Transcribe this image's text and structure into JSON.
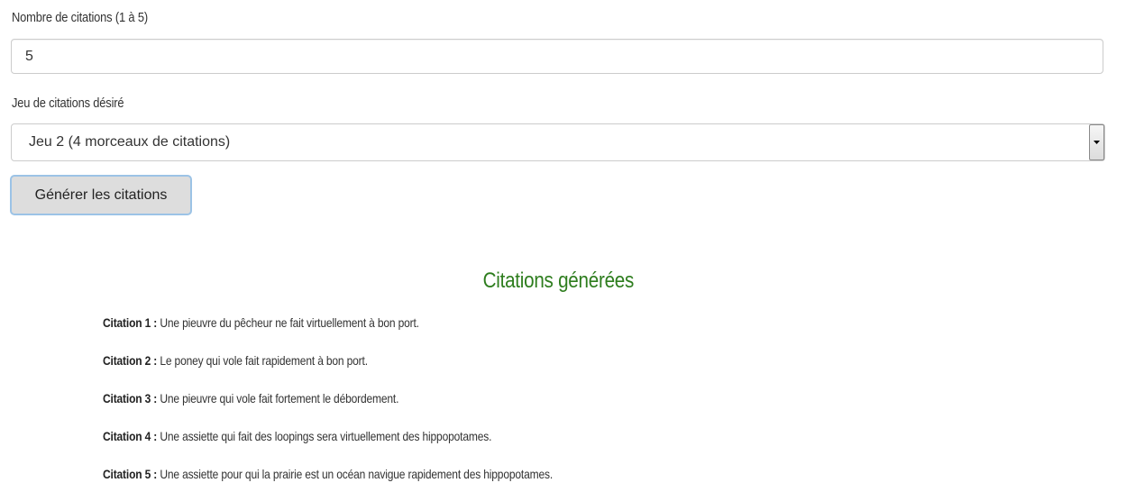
{
  "form": {
    "count_label": "Nombre de citations (1 à 5)",
    "count_value": "5",
    "set_label": "Jeu de citations désiré",
    "set_selected": "Jeu 2 (4 morceaux de citations)",
    "generate_label": "Générer les citations"
  },
  "results": {
    "title": "Citations générées",
    "color": "#2e7d1e",
    "quotes": [
      {
        "label": "Citation 1 :",
        "text": " Une pieuvre du pêcheur ne fait virtuellement à bon port."
      },
      {
        "label": "Citation 2 :",
        "text": " Le poney qui vole fait rapidement à bon port."
      },
      {
        "label": "Citation 3 :",
        "text": " Une pieuvre qui vole fait fortement le débordement."
      },
      {
        "label": "Citation 4 :",
        "text": " Une assiette qui fait des loopings sera virtuellement des hippopotames."
      },
      {
        "label": "Citation 5 :",
        "text": " Une assiette pour qui la prairie est un océan navigue rapidement des hippopotames."
      }
    ]
  },
  "icons": {
    "select_arrow": "triangle-down-icon"
  }
}
